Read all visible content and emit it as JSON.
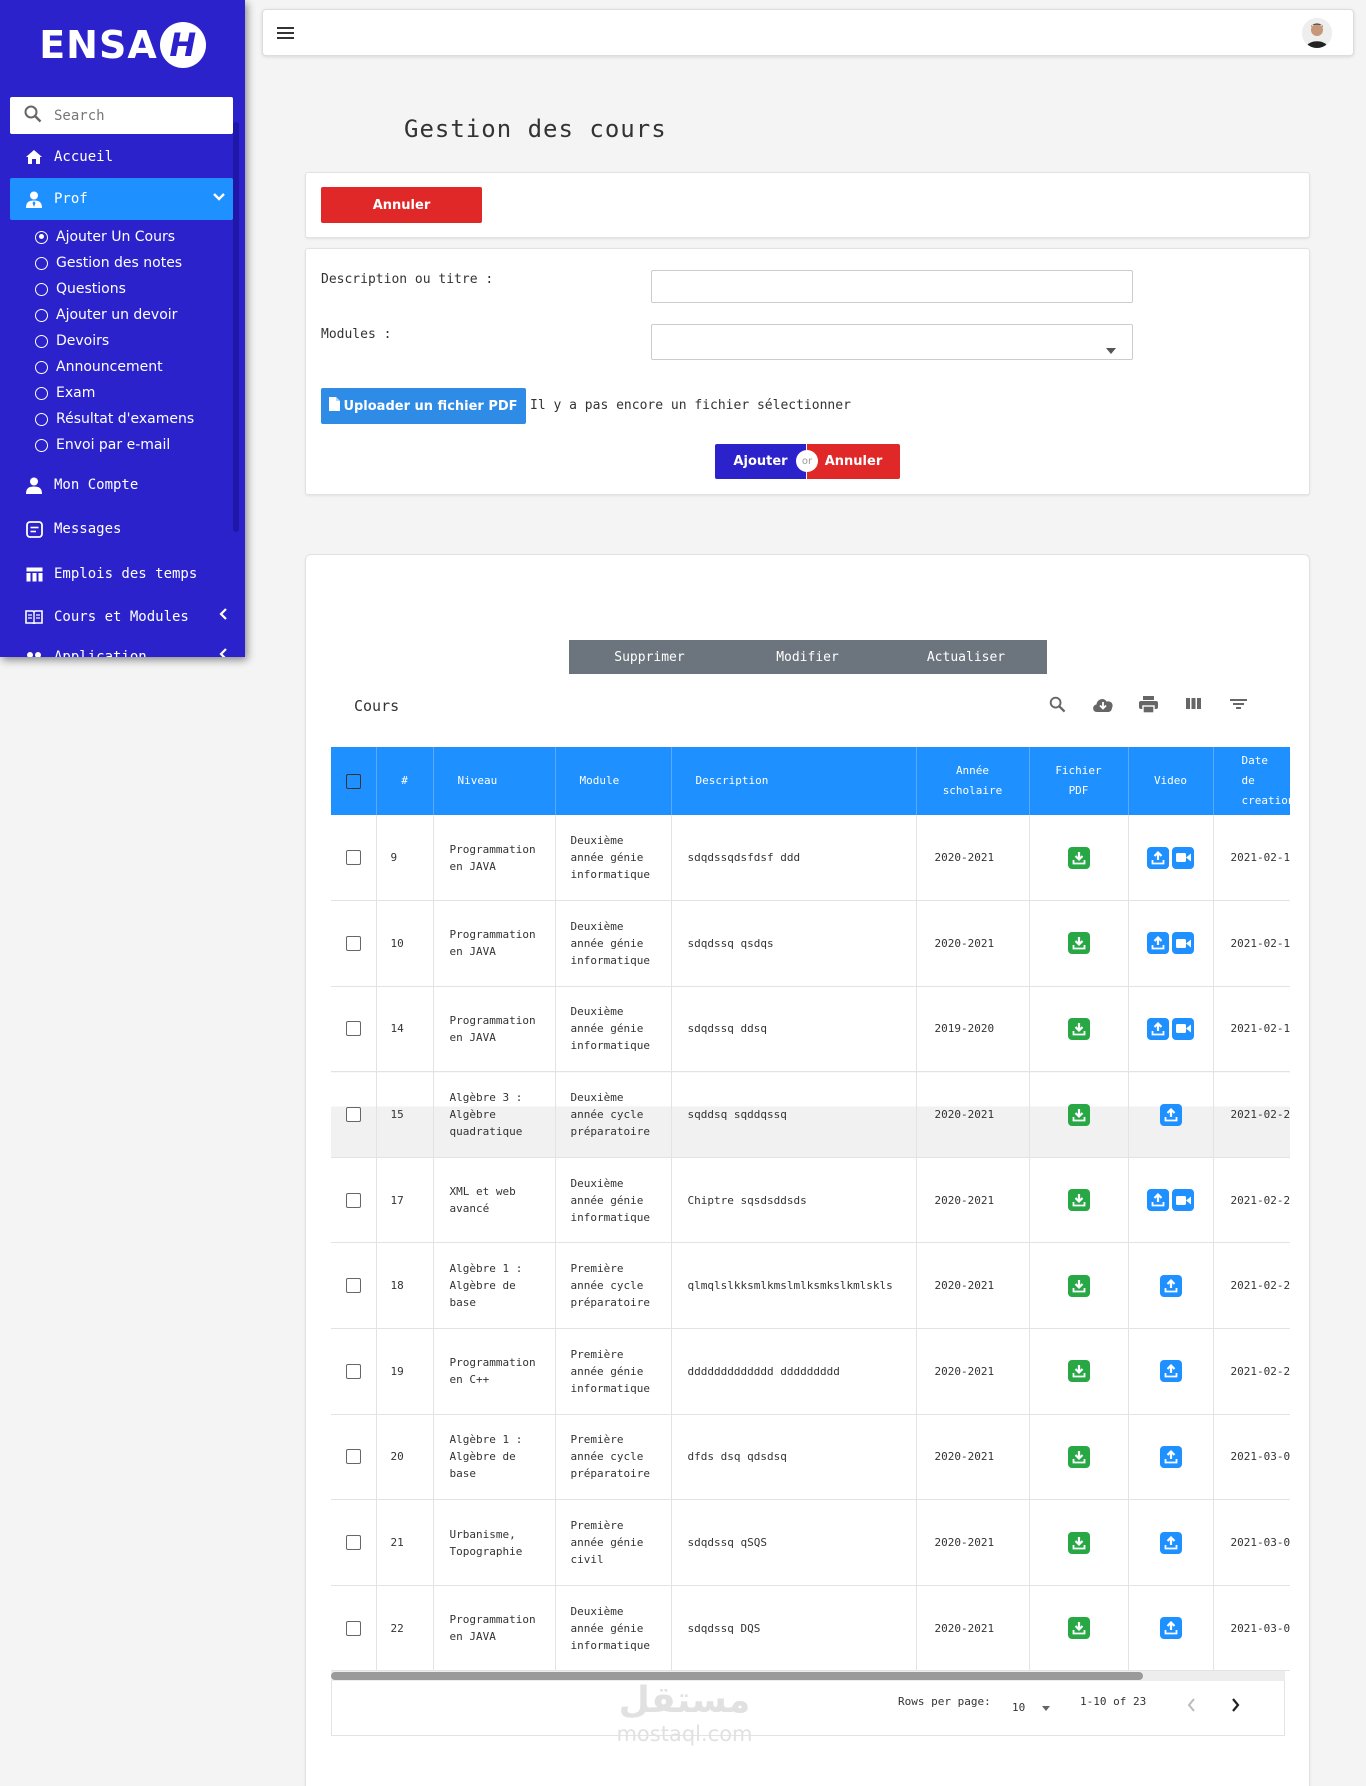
{
  "sidebar": {
    "logo_text": "ENSA",
    "logo_badge": "H",
    "search_placeholder": "Search",
    "items": [
      {
        "label": "Accueil",
        "icon": "home-icon"
      },
      {
        "label": "Prof",
        "icon": "user-tie-icon"
      },
      {
        "label": "Mon Compte",
        "icon": "user-icon"
      },
      {
        "label": "Messages",
        "icon": "message-icon"
      },
      {
        "label": "Emplois des temps",
        "icon": "table-icon"
      },
      {
        "label": "Cours et Modules",
        "icon": "book-icon"
      },
      {
        "label": "Application",
        "icon": "apps-icon"
      }
    ],
    "sub_items": [
      "Ajouter Un Cours",
      "Gestion des notes",
      "Questions",
      "Ajouter un devoir",
      "Devoirs",
      "Announcement",
      "Exam",
      "Résultat d'examens",
      "Envoi par e-mail"
    ]
  },
  "page_title": "Gestion des cours",
  "form": {
    "cancel_top": "Annuler",
    "description_label": "Description ou titre :",
    "modules_label": "Modules :",
    "upload_button": "Uploader un fichier PDF",
    "upload_status": "Il y a pas encore un fichier sélectionner",
    "add_button": "Ajouter",
    "or_text": "or",
    "cancel_button": "Annuler"
  },
  "table_toolbar": {
    "delete": "Supprimer",
    "edit": "Modifier",
    "refresh": "Actualiser"
  },
  "table_title": "Cours",
  "table": {
    "headers": [
      "#",
      "Niveau",
      "Module",
      "Description",
      "Année scholaire",
      "Fichier PDF",
      "Video",
      "Date de creation"
    ],
    "rows": [
      {
        "id": "9",
        "niveau": "Programmation en JAVA",
        "module": "Deuxième année génie informatique",
        "description": "sdqdssqdsfdsf ddd",
        "annee": "2020-2021",
        "video_cam": true,
        "date": "2021-02-1"
      },
      {
        "id": "10",
        "niveau": "Programmation en JAVA",
        "module": "Deuxième année génie informatique",
        "description": "sdqdssq qsdqs",
        "annee": "2020-2021",
        "video_cam": true,
        "date": "2021-02-1"
      },
      {
        "id": "14",
        "niveau": "Programmation en JAVA",
        "module": "Deuxième année génie informatique",
        "description": "sdqdssq ddsq",
        "annee": "2019-2020",
        "video_cam": true,
        "date": "2021-02-1"
      },
      {
        "id": "15",
        "niveau": "Algèbre 3 : Algèbre quadratique",
        "module": "Deuxième année cycle préparatoire",
        "description": "sqddsq sqddqssq",
        "annee": "2020-2021",
        "video_cam": false,
        "date": "2021-02-2"
      },
      {
        "id": "17",
        "niveau": "XML et web avancé",
        "module": "Deuxième année génie informatique",
        "description": "Chiptre sqsdsddsds",
        "annee": "2020-2021",
        "video_cam": true,
        "date": "2021-02-2"
      },
      {
        "id": "18",
        "niveau": "Algèbre 1 : Algèbre de base",
        "module": "Première année cycle préparatoire",
        "description": "qlmqlslkksmlkmslmlksmkslkmlskls",
        "annee": "2020-2021",
        "video_cam": false,
        "date": "2021-02-2"
      },
      {
        "id": "19",
        "niveau": "Programmation en C++",
        "module": "Première année génie informatique",
        "description": "ddddddddddddd ddddddddd",
        "annee": "2020-2021",
        "video_cam": false,
        "date": "2021-02-2"
      },
      {
        "id": "20",
        "niveau": "Algèbre 1 : Algèbre de base",
        "module": "Première année cycle préparatoire",
        "description": "dfds dsq qdsdsq",
        "annee": "2020-2021",
        "video_cam": false,
        "date": "2021-03-0"
      },
      {
        "id": "21",
        "niveau": "Urbanisme, Topographie",
        "module": "Première année génie civil",
        "description": "sdqdssq qSQS",
        "annee": "2020-2021",
        "video_cam": false,
        "date": "2021-03-0"
      },
      {
        "id": "22",
        "niveau": "Programmation en JAVA",
        "module": "Deuxième année génie informatique",
        "description": "sdqdssq DQS",
        "annee": "2020-2021",
        "video_cam": false,
        "date": "2021-03-0"
      }
    ]
  },
  "pagination": {
    "rows_label": "Rows per page:",
    "rows_value": "10",
    "range": "1-10 of 23"
  },
  "watermark": {
    "arabic": "مستقل",
    "latin": "mostaql.com"
  },
  "colors": {
    "sidebar": "#2b22cc",
    "accent": "#1e90ff",
    "danger": "#e02828",
    "success": "#28a745"
  }
}
